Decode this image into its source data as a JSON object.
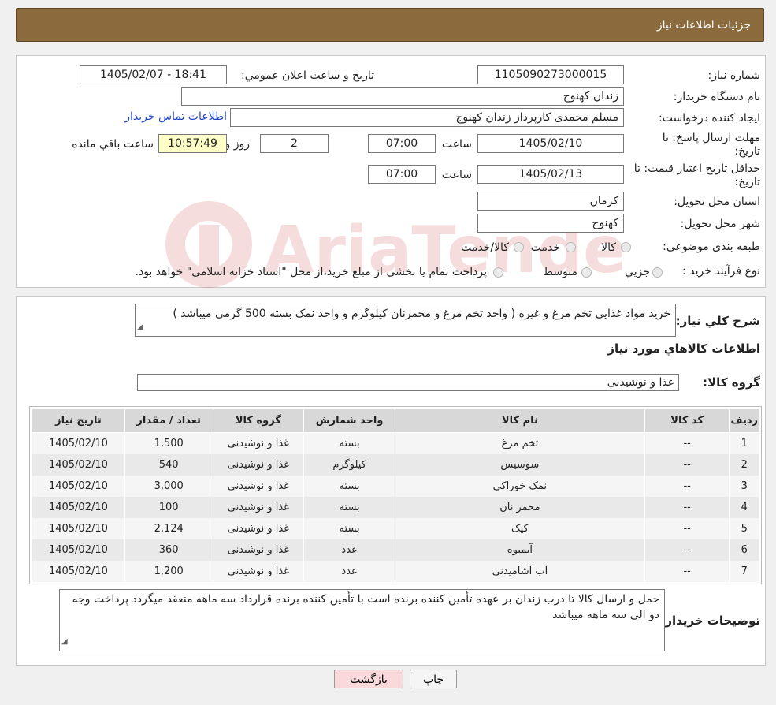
{
  "header": {
    "title": "جزئیات اطلاعات نیاز"
  },
  "form": {
    "need_number_label": "شماره نیاز:",
    "need_number": "1105090273000015",
    "announce_label": "تاریخ و ساعت اعلان عمومي:",
    "announce_value": "1405/02/07 - 18:41",
    "buyer_org_label": "نام دستگاه خریدار:",
    "buyer_org": "زندان کهنوج",
    "creator_label": "ایجاد کننده درخواست:",
    "creator": "مسلم محمدی کارپرداز زندان کهنوج",
    "contact_link": "اطلاعات تماس خریدار",
    "reply_deadline_label_1": "مهلت ارسال پاسخ: تا",
    "reply_deadline_label_2": "تاریخ:",
    "reply_date": "1405/02/10",
    "hour_label": "ساعت",
    "reply_time": "07:00",
    "days": "2",
    "days_label": "روز و",
    "remaining_time": "10:57:49",
    "remaining_label": "ساعت باقي مانده",
    "price_valid_label_1": "حداقل تاریخ اعتبار قیمت: تا",
    "price_valid_label_2": "تاریخ:",
    "price_valid_date": "1405/02/13",
    "price_valid_time": "07:00",
    "province_label": "استان محل تحویل:",
    "province": "کرمان",
    "city_label": "شهر محل تحویل:",
    "city": "کهنوج",
    "category_label": "طبقه بندی موضوعی:",
    "category_options": [
      "کالا",
      "خدمت",
      "کالا/خدمت"
    ],
    "process_label": "نوع فرآیند خرید :",
    "process_options": [
      "جزیي",
      "متوسط"
    ],
    "process_note": "پرداخت تمام یا بخشی از مبلغ خرید،از محل \"اسناد خزانه اسلامی\" خواهد بود."
  },
  "description": {
    "label": "شرح کلي نياز:",
    "text": "خرید مواد غذایی تخم مرغ و غیره ( واحد تخم مرغ و مخمرنان کیلوگرم و واحد نمک بسته 500 گرمی میباشد )"
  },
  "goods_section": {
    "title": "اطلاعات کالاهاي مورد نياز",
    "group_label": "گروه کالا:",
    "group_value": "غذا و نوشیدنی"
  },
  "table": {
    "headers": [
      "رديف",
      "کد کالا",
      "نام کالا",
      "واحد شمارش",
      "گروه کالا",
      "تعداد / مقدار",
      "تاریخ نیاز"
    ],
    "rows": [
      [
        "1",
        "--",
        "تخم مرغ",
        "بسته",
        "غذا و نوشیدنی",
        "1,500",
        "1405/02/10"
      ],
      [
        "2",
        "--",
        "سوسیس",
        "کیلوگرم",
        "غذا و نوشیدنی",
        "540",
        "1405/02/10"
      ],
      [
        "3",
        "--",
        "نمک خوراکی",
        "بسته",
        "غذا و نوشیدنی",
        "3,000",
        "1405/02/10"
      ],
      [
        "4",
        "--",
        "مخمر نان",
        "بسته",
        "غذا و نوشیدنی",
        "100",
        "1405/02/10"
      ],
      [
        "5",
        "--",
        "کیک",
        "بسته",
        "غذا و نوشیدنی",
        "2,124",
        "1405/02/10"
      ],
      [
        "6",
        "--",
        "آبمیوه",
        "عدد",
        "غذا و نوشیدنی",
        "360",
        "1405/02/10"
      ],
      [
        "7",
        "--",
        "آب آشامیدنی",
        "عدد",
        "غذا و نوشیدنی",
        "1,200",
        "1405/02/10"
      ]
    ]
  },
  "buyer_notes": {
    "label": "توضیحات خریدار:",
    "text": "حمل و  ارسال کالا تا درب زندان بر عهده تأمین کننده برنده است با تأمین کننده برنده قرارداد سه ماهه منعقد میگردد پرداخت وجه دو الی سه ماهه میباشد"
  },
  "buttons": {
    "print": "چاپ",
    "back": "بازگشت"
  },
  "watermark": {
    "text": "AriaTender.neT"
  },
  "colors": {
    "header_bg": "#8b6b3e",
    "link": "#2244cc",
    "back_button_bg": "#f9d9d9"
  }
}
